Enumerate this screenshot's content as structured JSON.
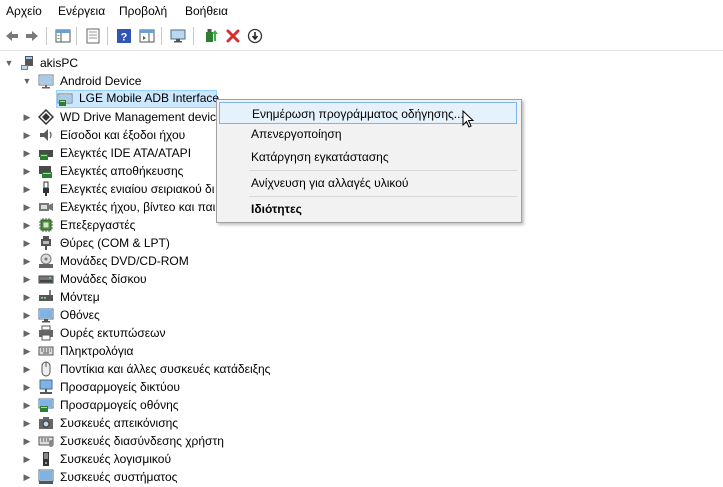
{
  "menu": [
    "Αρχείο",
    "Ενέργεια",
    "Προβολή",
    "Βοήθεια"
  ],
  "tree": {
    "root": "akisPC",
    "android": {
      "label": "Android Device",
      "child": "LGE Mobile ADB Interface"
    },
    "categories": [
      "WD Drive Management devic",
      "Είσοδοι και έξοδοι ήχου",
      "Ελεγκτές IDE ATA/ATAPI",
      "Ελεγκτές αποθήκευσης",
      "Ελεγκτές ενιαίου σειριακού δι",
      "Ελεγκτές ήχου, βίντεο και παι",
      "Επεξεργαστές",
      "Θύρες (COM & LPT)",
      "Μονάδες DVD/CD-ROM",
      "Μονάδες δίσκου",
      "Μόντεμ",
      "Οθόνες",
      "Ουρές εκτυπώσεων",
      "Πληκτρολόγια",
      "Ποντίκια και άλλες συσκευές κατάδειξης",
      "Προσαρμογείς δικτύου",
      "Προσαρμογείς οθόνης",
      "Συσκευές απεικόνισης",
      "Συσκευές διασύνδεσης χρήστη",
      "Συσκευές λογισμικού",
      "Συσκευές συστήματος"
    ]
  },
  "context_menu": {
    "update": "Ενημέρωση προγράμματος οδήγησης...",
    "disable": "Απενεργοποίηση",
    "uninstall": "Κατάργηση εγκατάστασης",
    "scan": "Ανίχνευση για αλλαγές υλικού",
    "properties": "Ιδιότητες"
  }
}
